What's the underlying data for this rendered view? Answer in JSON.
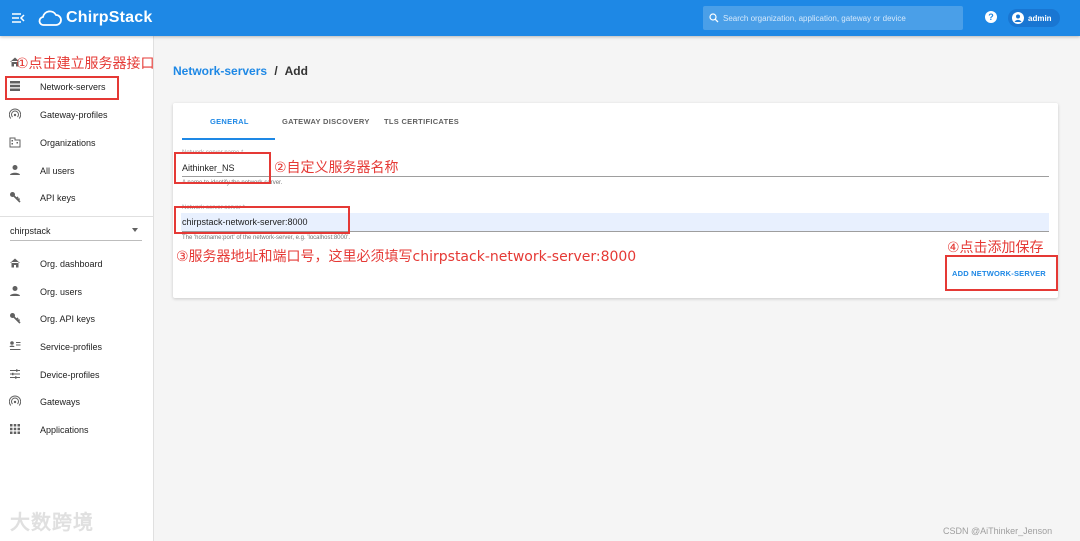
{
  "appbar": {
    "brand": "ChirpStack",
    "search_placeholder": "Search organization, application, gateway or device",
    "user": "admin"
  },
  "sidebar": {
    "top_items": [
      {
        "label": "Network-servers",
        "icon": "server-icon"
      },
      {
        "label": "Gateway-profiles",
        "icon": "wifi-icon"
      },
      {
        "label": "Organizations",
        "icon": "building-icon"
      },
      {
        "label": "All users",
        "icon": "user-icon"
      },
      {
        "label": "API keys",
        "icon": "key-icon"
      }
    ],
    "org_selected": "chirpstack",
    "org_items": [
      {
        "label": "Org. dashboard",
        "icon": "home-icon"
      },
      {
        "label": "Org. users",
        "icon": "user-icon"
      },
      {
        "label": "Org. API keys",
        "icon": "key-icon"
      },
      {
        "label": "Service-profiles",
        "icon": "profile-list-icon"
      },
      {
        "label": "Device-profiles",
        "icon": "sliders-icon"
      },
      {
        "label": "Gateways",
        "icon": "wifi-icon"
      },
      {
        "label": "Applications",
        "icon": "grid-icon"
      }
    ]
  },
  "breadcrumb": {
    "parent": "Network-servers",
    "separator": "/",
    "current": "Add"
  },
  "tabs": [
    "GENERAL",
    "GATEWAY DISCOVERY",
    "TLS CERTIFICATES"
  ],
  "form": {
    "name_label": "Network-server name *",
    "name_value": "Aithinker_NS",
    "name_helper": "A name to identify the network-server.",
    "server_label": "Network-server server *",
    "server_value": "chirpstack-network-server:8000",
    "server_helper": "The 'hostname:port' of the network-server, e.g. 'localhost:8000'.",
    "submit_label": "ADD NETWORK-SERVER"
  },
  "annotations": {
    "step1": "①点击建立服务器接口",
    "step2": "②自定义服务器名称",
    "step3": "③服务器地址和端口号，这里必须填写chirpstack-network-server:8000",
    "step4": "④点击添加保存",
    "color": "#e53935"
  },
  "watermark": "大数跨境",
  "credit": "CSDN @AiThinker_Jenson",
  "colors": {
    "primary": "#1e88e5",
    "annotation": "#e53935"
  }
}
